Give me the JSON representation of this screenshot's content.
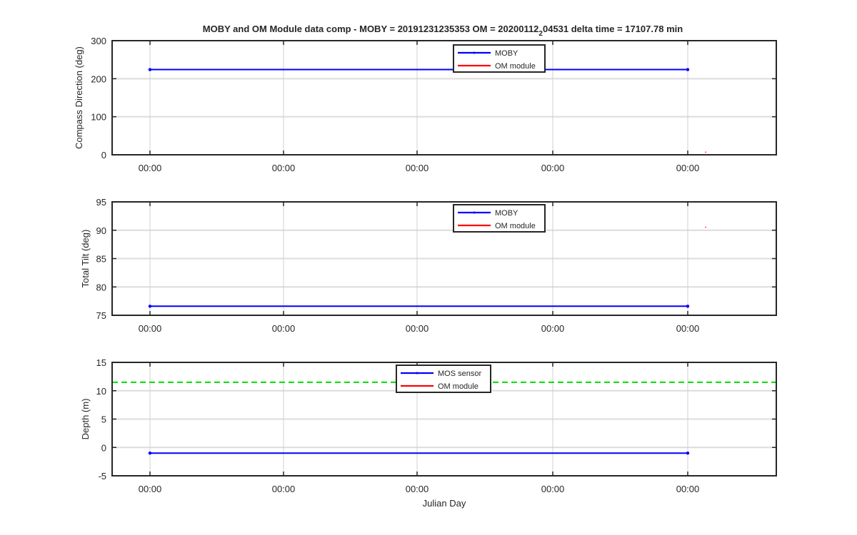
{
  "figure": {
    "title_main": "MOBY and OM Module data comp - MOBY = 20191231235353 OM = 20200112",
    "title_sub": "2",
    "title_tail": "04531 delta time = 17107.78 min"
  },
  "chart_data": [
    {
      "type": "line",
      "ylabel": "Compass Direction (deg)",
      "xlabel": "",
      "ylim": [
        0,
        300
      ],
      "yticks": [
        "0",
        "100",
        "200",
        "300"
      ],
      "xticklabels": [
        "00:00",
        "00:00",
        "00:00",
        "00:00",
        "00:00"
      ],
      "grid": true,
      "legend_position": "top-center",
      "series": [
        {
          "name": "MOBY",
          "color": "#0000ff",
          "style": "solid-with-dots",
          "x": [
            0,
            4
          ],
          "y": [
            224,
            224
          ]
        },
        {
          "name": "OM module",
          "color": "#ff0000",
          "style": "solid",
          "x": [
            4.13
          ],
          "y": [
            8
          ]
        }
      ]
    },
    {
      "type": "line",
      "ylabel": "Total Tilt (deg)",
      "xlabel": "",
      "ylim": [
        75,
        95
      ],
      "yticks": [
        "75",
        "80",
        "85",
        "90",
        "95"
      ],
      "xticklabels": [
        "00:00",
        "00:00",
        "00:00",
        "00:00",
        "00:00"
      ],
      "grid": true,
      "legend_position": "top-center",
      "series": [
        {
          "name": "MOBY",
          "color": "#0000ff",
          "style": "solid-with-dots",
          "x": [
            0,
            4
          ],
          "y": [
            76.6,
            76.6
          ]
        },
        {
          "name": "OM module",
          "color": "#ff0000",
          "style": "solid",
          "x": [
            4.13
          ],
          "y": [
            90.6
          ]
        }
      ]
    },
    {
      "type": "line",
      "ylabel": "Depth (m)",
      "xlabel": "Julian Day",
      "ylim": [
        -5,
        15
      ],
      "yticks": [
        "-5",
        "0",
        "5",
        "10",
        "15"
      ],
      "xticklabels": [
        "00:00",
        "00:00",
        "00:00",
        "00:00",
        "00:00"
      ],
      "grid": true,
      "legend_position": "top-center",
      "series": [
        {
          "name": "MOS sensor",
          "color": "#0000ff",
          "style": "solid-with-dots",
          "x": [
            0,
            4
          ],
          "y": [
            -1,
            -1
          ]
        },
        {
          "name": "OM module",
          "color": "#ff0000",
          "style": "solid",
          "x": [],
          "y": []
        }
      ],
      "reference_line": {
        "color": "#00dd00",
        "style": "dashed",
        "y": 11.5
      }
    }
  ]
}
